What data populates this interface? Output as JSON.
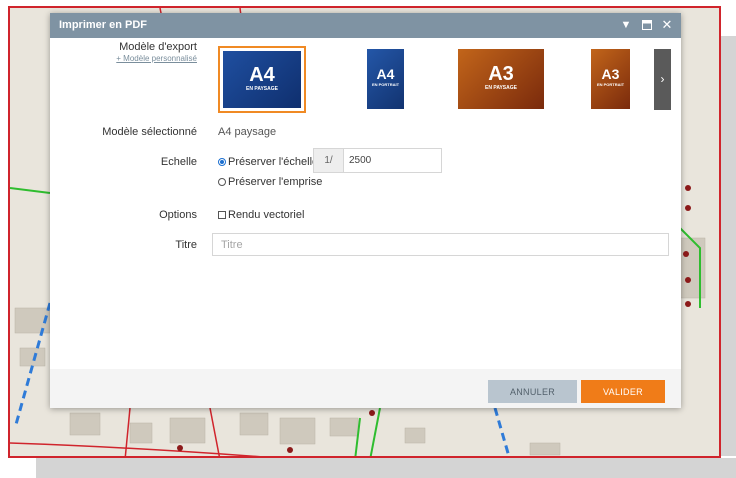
{
  "dialog": {
    "title": "Imprimer en PDF"
  },
  "export_model": {
    "label": "Modèle d'export",
    "custom_link": "+ Modèle personnalisé",
    "templates": [
      {
        "format": "A4",
        "orientation": "EN PAYSAGE",
        "selected": true
      },
      {
        "format": "A4",
        "orientation": "EN PORTRAIT",
        "selected": false
      },
      {
        "format": "A3",
        "orientation": "EN PAYSAGE",
        "selected": false
      },
      {
        "format": "A3",
        "orientation": "EN PORTRAIT",
        "selected": false
      }
    ]
  },
  "selected_model": {
    "label": "Modèle sélectionné",
    "value": "A4 paysage"
  },
  "scale": {
    "label": "Echelle",
    "preserve_scale": "Préserver l'échelle",
    "preserve_extent": "Préserver l'emprise",
    "prefix": "1/",
    "value": "2500"
  },
  "options": {
    "label": "Options",
    "vector_render": "Rendu vectoriel"
  },
  "title_field": {
    "label": "Titre",
    "placeholder": "Titre"
  },
  "buttons": {
    "cancel": "ANNULER",
    "validate": "VALIDER"
  },
  "colors": {
    "titlebar": "#7f93a3",
    "accent": "#f07c18",
    "map_border": "#d0242c"
  },
  "icons": {
    "dropdown": "chevron-down-icon",
    "maximize": "maximize-icon",
    "close": "close-icon",
    "next": "chevron-right-icon"
  }
}
